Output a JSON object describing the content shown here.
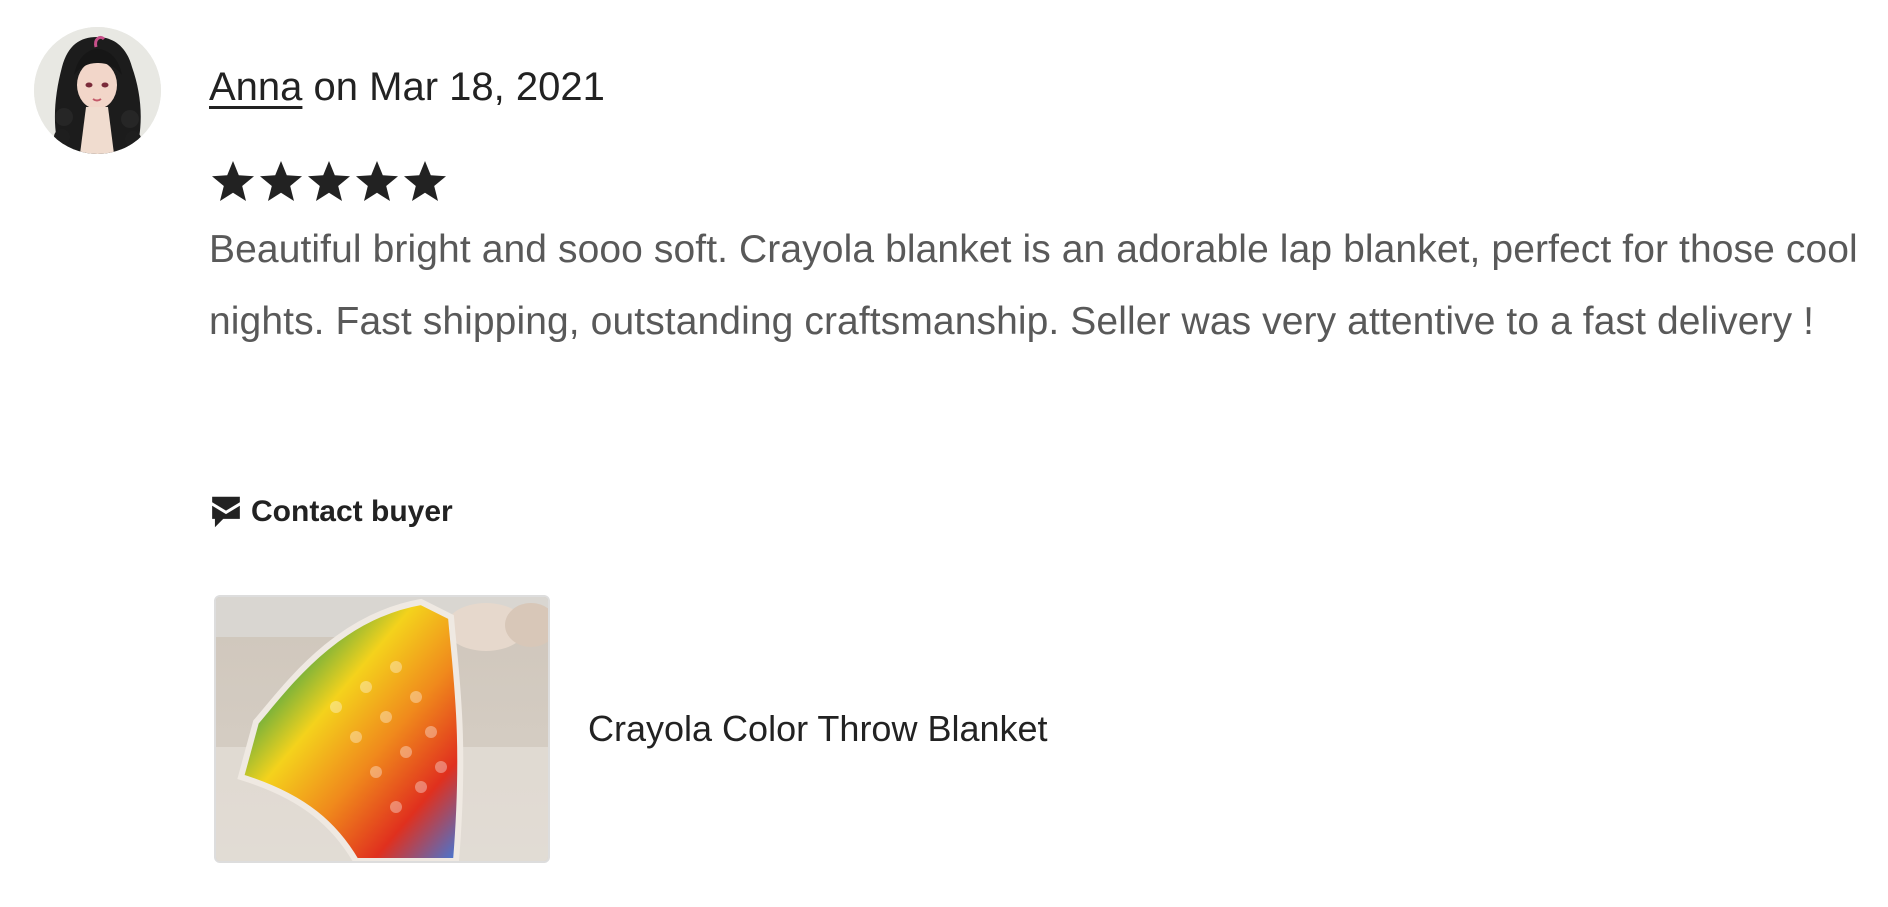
{
  "review": {
    "reviewer_name": "Anna",
    "date_text": " on Mar 18, 2021",
    "rating": 5,
    "rating_max": 5,
    "text": "Beautiful bright and sooo soft. Crayola blanket is an adorable lap blanket, perfect for those cool nights. Fast shipping, outstanding craftsmanship. Seller was very attentive to a fast delivery !",
    "contact_label": "Contact buyer",
    "product": {
      "title": "Crayola Color Throw Blanket"
    }
  },
  "icons": {
    "avatar": "avatar-image",
    "star": "star-icon",
    "contact": "envelope-icon",
    "product_image": "blanket-photo"
  },
  "colors": {
    "text_primary": "#222222",
    "text_secondary": "#595959",
    "star": "#222222",
    "thumb_border": "#dddddd"
  }
}
